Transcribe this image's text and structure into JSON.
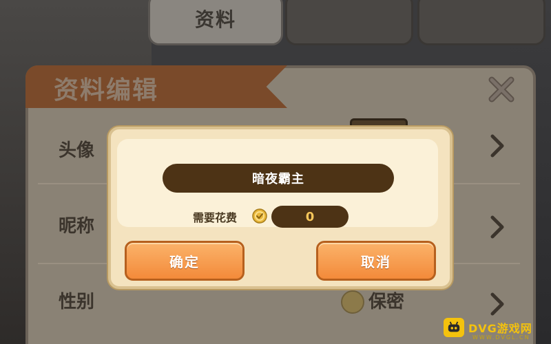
{
  "tabs": [
    {
      "label": "资料"
    },
    {
      "label": ""
    },
    {
      "label": ""
    }
  ],
  "panel": {
    "title": "资料编辑",
    "rows": [
      {
        "label": "头像"
      },
      {
        "label": "昵称"
      },
      {
        "label": "性别",
        "value": "保密"
      }
    ]
  },
  "dialog": {
    "name": "暗夜霸主",
    "cost_label": "需要花费",
    "cost_value": "0",
    "confirm_label": "确定",
    "cancel_label": "取消"
  },
  "watermark": {
    "text": "DVG游戏网",
    "sub": "WWW.DVGL.CN"
  },
  "colors": {
    "accent_orange": "#f38a3a",
    "dark_brown": "#4d3315",
    "dialog_bg": "#f4e3bf",
    "coin_gold": "#f6c65a"
  },
  "icons": [
    "close-icon",
    "chevron-right-icon",
    "coin-icon",
    "gender-icon",
    "dvg-logo-icon"
  ]
}
